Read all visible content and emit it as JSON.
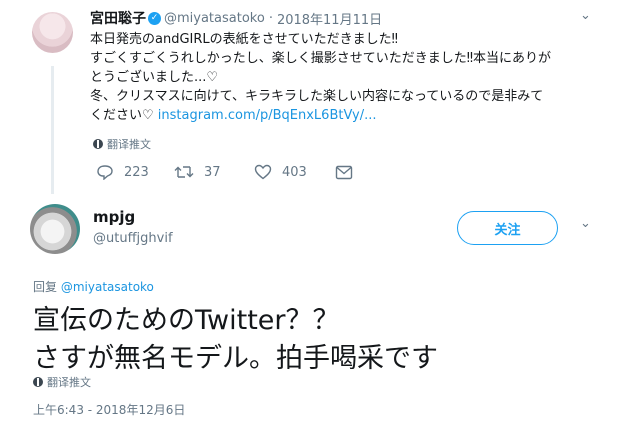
{
  "tweet1": {
    "name": "宮田聡子",
    "handle": "@miyatasatoko",
    "separator": "·",
    "date": "2018年11月11日",
    "lines": [
      "本日発売のandGIRLの表紙をさせていただきました‼",
      "すごくすごくうれしかったし、楽しく撮影させていただきました‼本当にありが",
      "とうございました...♡",
      "冬、クリスマスに向けて、キラキラした楽しい内容になっているので是非みて",
      "ください♡ "
    ],
    "link": "instagram.com/p/BqEnxL6BtVy/...",
    "translate": "翻译推文",
    "actions": {
      "replies": "223",
      "retweets": "37",
      "likes": "403"
    },
    "chevron": "⌄",
    "verified_mark": "✓"
  },
  "tweet2": {
    "name": "mpjg",
    "handle": "@utuffjghvif",
    "follow_label": "关注",
    "chevron": "⌄",
    "reply_prefix": "回复",
    "reply_to": "@miyatasatoko",
    "body_lines": [
      "宣伝のためのTwitter？？",
      "さすが無名モデル。拍手喝采です"
    ],
    "translate": "翻译推文",
    "timestamp": "上午6:43 - 2018年12月6日"
  }
}
